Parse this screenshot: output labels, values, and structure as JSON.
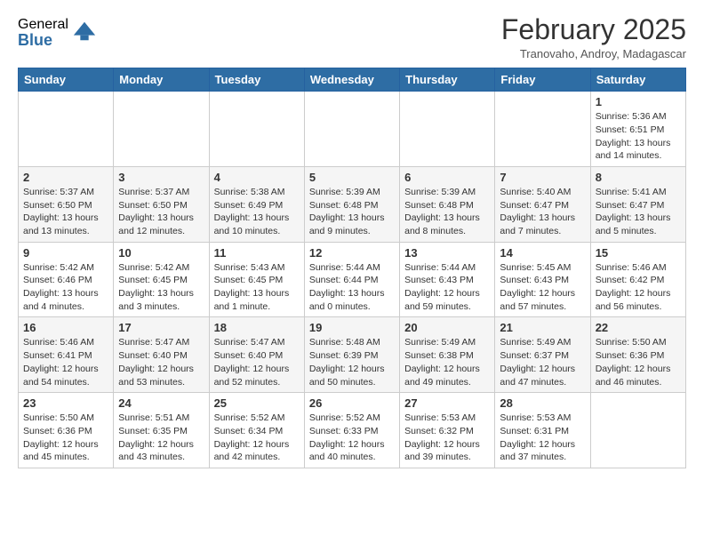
{
  "logo": {
    "general": "General",
    "blue": "Blue"
  },
  "header": {
    "month": "February 2025",
    "location": "Tranovaho, Androy, Madagascar"
  },
  "days_of_week": [
    "Sunday",
    "Monday",
    "Tuesday",
    "Wednesday",
    "Thursday",
    "Friday",
    "Saturday"
  ],
  "weeks": [
    [
      null,
      null,
      null,
      null,
      null,
      null,
      {
        "day": "1",
        "sunrise": "5:36 AM",
        "sunset": "6:51 PM",
        "daylight": "13 hours and 14 minutes."
      }
    ],
    [
      {
        "day": "2",
        "sunrise": "5:37 AM",
        "sunset": "6:50 PM",
        "daylight": "13 hours and 13 minutes."
      },
      {
        "day": "3",
        "sunrise": "5:37 AM",
        "sunset": "6:50 PM",
        "daylight": "13 hours and 12 minutes."
      },
      {
        "day": "4",
        "sunrise": "5:38 AM",
        "sunset": "6:49 PM",
        "daylight": "13 hours and 10 minutes."
      },
      {
        "day": "5",
        "sunrise": "5:39 AM",
        "sunset": "6:48 PM",
        "daylight": "13 hours and 9 minutes."
      },
      {
        "day": "6",
        "sunrise": "5:39 AM",
        "sunset": "6:48 PM",
        "daylight": "13 hours and 8 minutes."
      },
      {
        "day": "7",
        "sunrise": "5:40 AM",
        "sunset": "6:47 PM",
        "daylight": "13 hours and 7 minutes."
      },
      {
        "day": "8",
        "sunrise": "5:41 AM",
        "sunset": "6:47 PM",
        "daylight": "13 hours and 5 minutes."
      }
    ],
    [
      {
        "day": "9",
        "sunrise": "5:42 AM",
        "sunset": "6:46 PM",
        "daylight": "13 hours and 4 minutes."
      },
      {
        "day": "10",
        "sunrise": "5:42 AM",
        "sunset": "6:45 PM",
        "daylight": "13 hours and 3 minutes."
      },
      {
        "day": "11",
        "sunrise": "5:43 AM",
        "sunset": "6:45 PM",
        "daylight": "13 hours and 1 minute."
      },
      {
        "day": "12",
        "sunrise": "5:44 AM",
        "sunset": "6:44 PM",
        "daylight": "13 hours and 0 minutes."
      },
      {
        "day": "13",
        "sunrise": "5:44 AM",
        "sunset": "6:43 PM",
        "daylight": "12 hours and 59 minutes."
      },
      {
        "day": "14",
        "sunrise": "5:45 AM",
        "sunset": "6:43 PM",
        "daylight": "12 hours and 57 minutes."
      },
      {
        "day": "15",
        "sunrise": "5:46 AM",
        "sunset": "6:42 PM",
        "daylight": "12 hours and 56 minutes."
      }
    ],
    [
      {
        "day": "16",
        "sunrise": "5:46 AM",
        "sunset": "6:41 PM",
        "daylight": "12 hours and 54 minutes."
      },
      {
        "day": "17",
        "sunrise": "5:47 AM",
        "sunset": "6:40 PM",
        "daylight": "12 hours and 53 minutes."
      },
      {
        "day": "18",
        "sunrise": "5:47 AM",
        "sunset": "6:40 PM",
        "daylight": "12 hours and 52 minutes."
      },
      {
        "day": "19",
        "sunrise": "5:48 AM",
        "sunset": "6:39 PM",
        "daylight": "12 hours and 50 minutes."
      },
      {
        "day": "20",
        "sunrise": "5:49 AM",
        "sunset": "6:38 PM",
        "daylight": "12 hours and 49 minutes."
      },
      {
        "day": "21",
        "sunrise": "5:49 AM",
        "sunset": "6:37 PM",
        "daylight": "12 hours and 47 minutes."
      },
      {
        "day": "22",
        "sunrise": "5:50 AM",
        "sunset": "6:36 PM",
        "daylight": "12 hours and 46 minutes."
      }
    ],
    [
      {
        "day": "23",
        "sunrise": "5:50 AM",
        "sunset": "6:36 PM",
        "daylight": "12 hours and 45 minutes."
      },
      {
        "day": "24",
        "sunrise": "5:51 AM",
        "sunset": "6:35 PM",
        "daylight": "12 hours and 43 minutes."
      },
      {
        "day": "25",
        "sunrise": "5:52 AM",
        "sunset": "6:34 PM",
        "daylight": "12 hours and 42 minutes."
      },
      {
        "day": "26",
        "sunrise": "5:52 AM",
        "sunset": "6:33 PM",
        "daylight": "12 hours and 40 minutes."
      },
      {
        "day": "27",
        "sunrise": "5:53 AM",
        "sunset": "6:32 PM",
        "daylight": "12 hours and 39 minutes."
      },
      {
        "day": "28",
        "sunrise": "5:53 AM",
        "sunset": "6:31 PM",
        "daylight": "12 hours and 37 minutes."
      },
      null
    ]
  ]
}
